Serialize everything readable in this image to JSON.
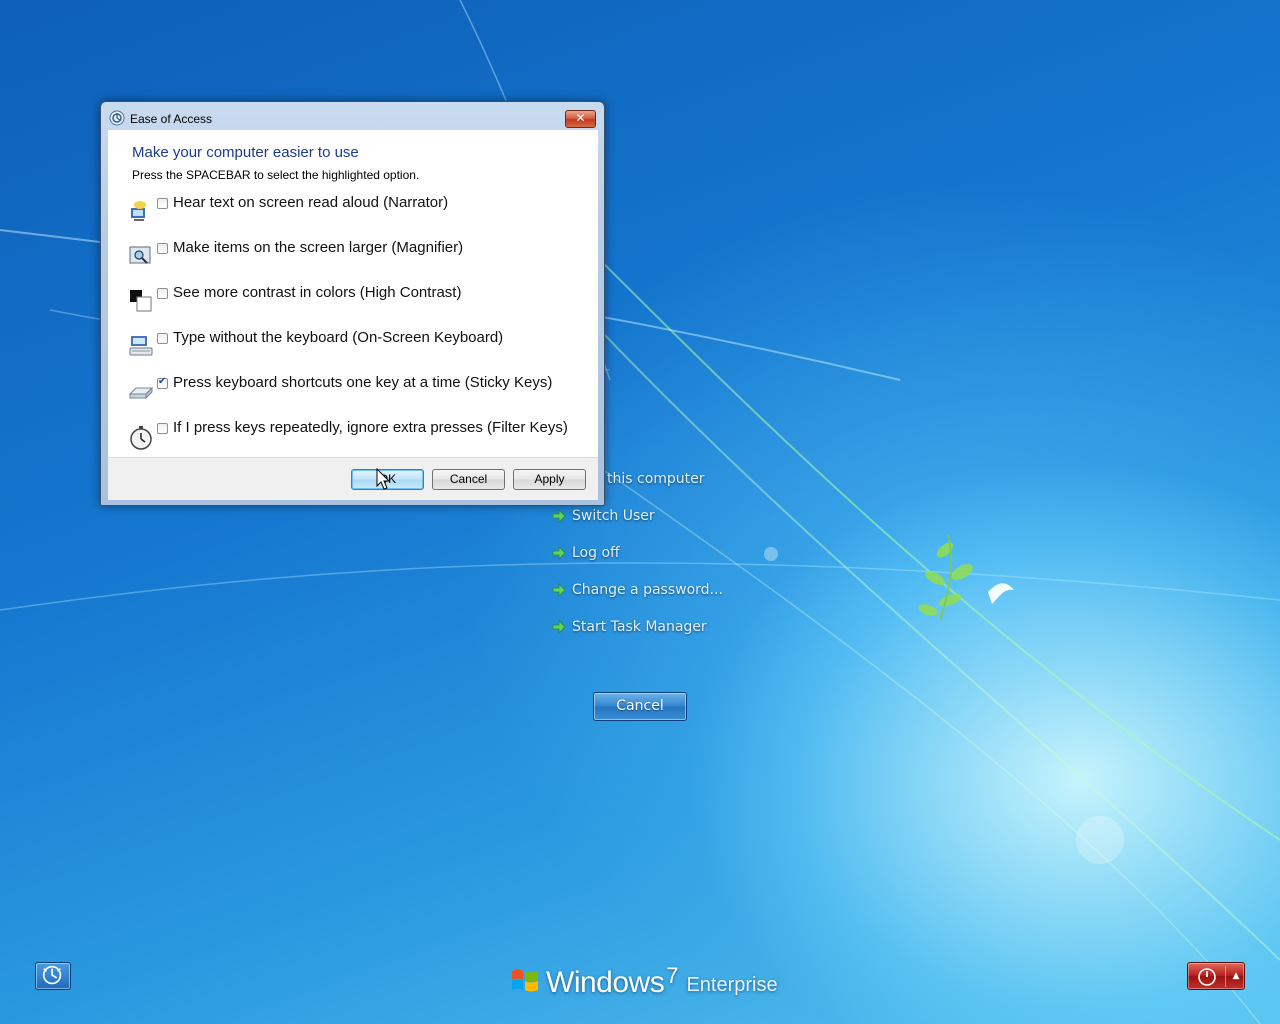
{
  "dialog": {
    "title": "Ease of Access",
    "heading": "Make your computer easier to use",
    "subtext": "Press the SPACEBAR to select the highlighted option.",
    "options": [
      {
        "label": "Hear text on screen read aloud (Narrator)",
        "checked": false,
        "icon": "narrator-icon"
      },
      {
        "label": "Make items on the screen larger (Magnifier)",
        "checked": false,
        "icon": "magnifier-icon"
      },
      {
        "label": "See more contrast in colors (High Contrast)",
        "checked": false,
        "icon": "high-contrast-icon"
      },
      {
        "label": "Type without the keyboard (On-Screen Keyboard)",
        "checked": false,
        "icon": "keyboard-icon"
      },
      {
        "label": "Press keyboard shortcuts one key at a time (Sticky Keys)",
        "checked": true,
        "icon": "sticky-keys-icon"
      },
      {
        "label": "If I press keys repeatedly, ignore extra presses (Filter Keys)",
        "checked": false,
        "icon": "filter-keys-icon"
      }
    ],
    "ok_label": "OK",
    "cancel_label": "Cancel",
    "apply_label": "Apply",
    "close_label": "✕"
  },
  "security_menu": {
    "items": [
      "Lock this computer",
      "Switch User",
      "Log off",
      "Change a password...",
      "Start Task Manager"
    ],
    "partial_first_item": "this computer",
    "cancel_label": "Cancel"
  },
  "branding": {
    "name": "Windows",
    "version": "7",
    "edition": "Enterprise"
  },
  "colors": {
    "heading": "#1c3c8c",
    "power_button": "#b41e1e",
    "desktop_blue": "#1577d0"
  }
}
